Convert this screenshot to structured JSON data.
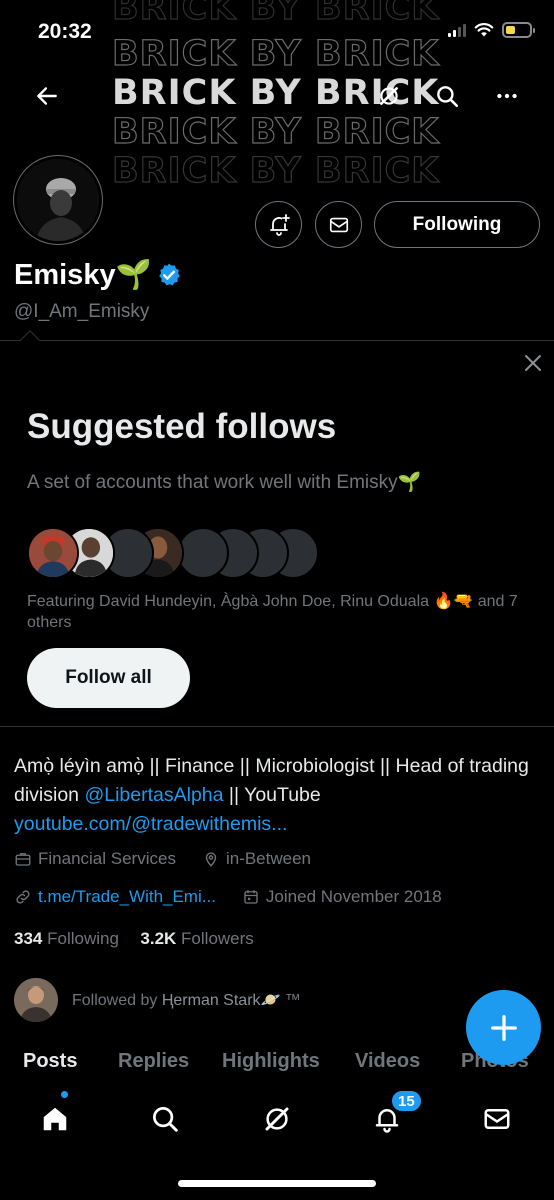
{
  "status_bar": {
    "time": "20:32"
  },
  "banner": {
    "repeated_text": "BRICK BY BRICK"
  },
  "header": {
    "back_icon": "arrow-left-icon",
    "grok_icon": "grok-icon",
    "search_icon": "search-icon",
    "more_icon": "more-icon"
  },
  "profile": {
    "display_name": "Emisky🌱",
    "verified": true,
    "handle": "@I_Am_Emisky",
    "following_button": "Following",
    "bio_text": "Amọ̀ léyìn amọ̀ || Finance || Microbiologist || Head of trading division ",
    "bio_mention": "@LibertasAlpha",
    "bio_after_mention": " || YouTube",
    "bio_link": "youtube.com/@tradewithemis...",
    "category": "Financial Services",
    "location": "in-Between",
    "website": "t.me/Trade_With_Emi...",
    "joined": "Joined November 2018",
    "following_count": "334",
    "following_label": "Following",
    "followers_count": "3.2K",
    "followers_label": "Followers",
    "followed_by_prefix": "Followed by ",
    "followed_by_name": "Ⱨerman Stark🪐",
    "followed_by_suffix": " ™"
  },
  "suggested": {
    "title": "Suggested follows",
    "subtitle": "A set of accounts that work well with Emisky🌱",
    "featuring": "Featuring David Hundeyin, Àgbà John Doe, Rinu Oduala 🔥🔫 and 7 others",
    "follow_all_button": "Follow all"
  },
  "tabs": [
    "Posts",
    "Replies",
    "Highlights",
    "Videos",
    "Photos"
  ],
  "active_tab": "Posts",
  "bottom_nav": {
    "items": [
      "home-icon",
      "search-icon",
      "grok-icon",
      "notifications-icon",
      "messages-icon"
    ],
    "notifications_badge": "15"
  },
  "colors": {
    "accent": "#1d9bf0",
    "background": "#000000",
    "text_primary": "#e7e9ea",
    "text_secondary": "#71767b",
    "border": "#2f3336"
  }
}
